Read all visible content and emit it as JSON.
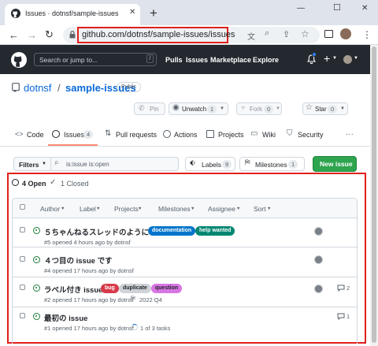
{
  "browser": {
    "tab_title": "Issues · dotnsf/sample-issues",
    "url": "github.com/dotnsf/sample-issues/issues",
    "add_tab": "+",
    "win_min": "—",
    "win_max": "☐",
    "win_close": "✕"
  },
  "header": {
    "search_placeholder": "Search or jump to...",
    "search_key": "/",
    "nav": [
      "Pulls",
      "Issues",
      "Marketplace",
      "Explore"
    ],
    "plus": "+"
  },
  "repo": {
    "owner": "dotnsf",
    "separator": "/",
    "name": "sample-issues",
    "visibility": "Public",
    "pin_label": "Pin",
    "unwatch_label": "Unwatch",
    "unwatch_count": "1",
    "fork_label": "Fork",
    "fork_count": "0",
    "star_label": "Star",
    "star_count": "0"
  },
  "tabs": {
    "code": "Code",
    "issues": "Issues",
    "issues_count": "4",
    "pulls": "Pull requests",
    "actions": "Actions",
    "projects": "Projects",
    "wiki": "Wiki",
    "security": "Security",
    "more": "···"
  },
  "filterbar": {
    "filters_label": "Filters",
    "search_value": "is:issue is:open",
    "labels_label": "Labels",
    "labels_count": "9",
    "milestones_label": "Milestones",
    "milestones_count": "1",
    "new_issue_label": "New issue"
  },
  "issues_header": {
    "open_label": "4 Open",
    "closed_label": "1 Closed",
    "columns": [
      "Author",
      "Label",
      "Projects",
      "Milestones",
      "Assignee",
      "Sort"
    ]
  },
  "issues": [
    {
      "title": "５ちゃんねるスレッドのように",
      "labels": [
        {
          "text": "documentation",
          "color": "#0075ca"
        },
        {
          "text": "help wanted",
          "color": "#008672"
        }
      ],
      "meta": "#5 opened 4 hours ago by dotnsf",
      "extra": "",
      "comments": ""
    },
    {
      "title": "４つ目の issue です",
      "labels": [],
      "meta": "#4 opened 17 hours ago by dotnsf",
      "extra": "",
      "comments": ""
    },
    {
      "title": "ラベル付き issue",
      "labels": [
        {
          "text": "bug",
          "color": "#d73a4a"
        },
        {
          "text": "duplicate",
          "color": "#cfd3d7"
        },
        {
          "text": "question",
          "color": "#d876e3"
        }
      ],
      "meta": "#2 opened 17 hours ago by dotnsf",
      "extra": "2022 Q4",
      "comments": "2"
    },
    {
      "title": "最初の issue",
      "labels": [],
      "meta": "#1 opened 17 hours ago by dotnsf",
      "extra": "1 of 3 tasks",
      "comments": "1"
    }
  ],
  "colors": {
    "highlight": "#e0201b",
    "github_dark": "#24292f",
    "primary_green": "#2da44e",
    "open_green": "#1a7f37",
    "link_blue": "#0969da",
    "tab_underline": "#fd8c73"
  }
}
